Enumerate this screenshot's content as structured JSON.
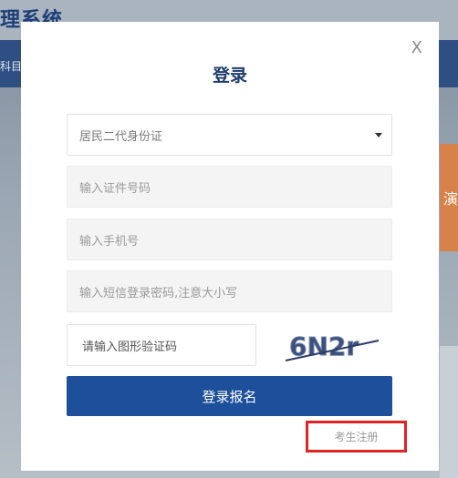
{
  "background": {
    "title_fragment": "理系统",
    "nav_fragment": "科目",
    "side_fragment": "演"
  },
  "modal": {
    "close_label": "X",
    "title": "登录",
    "id_type_select": {
      "selected": "居民二代身份证"
    },
    "id_number_input": {
      "placeholder": "输入证件号码"
    },
    "phone_input": {
      "placeholder": "输入手机号"
    },
    "sms_password_input": {
      "placeholder": "输入短信登录密码,注意大小写"
    },
    "captcha_input": {
      "placeholder": "请输入图形验证码"
    },
    "captcha_text": "6N2r",
    "submit_label": "登录报名",
    "register_label": "考生注册"
  },
  "colors": {
    "primary": "#1d4f9b",
    "title": "#1f3c6e",
    "highlight": "#e02424"
  }
}
